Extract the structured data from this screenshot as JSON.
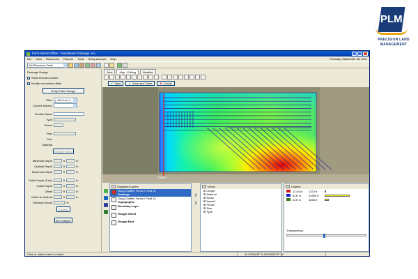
{
  "logo": {
    "mark": "PLM",
    "line1": "PRECISION LAND",
    "line2": "MANAGEMENT"
  },
  "window": {
    "title": "Farm Works Office - Nussbaum Drainage, Inc.",
    "menu": [
      "File",
      "View",
      "Resources",
      "Reports",
      "Tools",
      "Setup Account",
      "Help"
    ],
    "date": "Thursday, September 08, 2011",
    "toolbar_combo": "Job/Resource Tools"
  },
  "left_panel": {
    "title": "Drainage Design",
    "checkboxes": [
      {
        "label": "Show feet and inches",
        "checked": true
      },
      {
        "label": "Modify connection offset",
        "checked": true
      }
    ],
    "verify_button": "Verify Entire Design",
    "filter_label": "Filter",
    "filter_value": "(~All Lines~)",
    "current_section_label": "Current Section",
    "fields": [
      "Section Name",
      "Type",
      "Phase"
    ],
    "pipe_fields": [
      "Pipe",
      "Size",
      "Material"
    ],
    "multiple_sizes_button": "Multiple Sizes",
    "depth_rows": [
      "Minimum Depth",
      "Optimal Depth",
      "Maximum Depth"
    ],
    "outlet_rows": [
      "Outlet Depth (Calc)",
      "Outlet Depth",
      "Offset",
      "Outlet to Optimal",
      "Minimum Slope"
    ],
    "feet_unit": "ft",
    "inch_unit": "in",
    "slope_unit": "%",
    "update_button": "Update",
    "set_defaults_button": "Set Defaults"
  },
  "tabs": [
    "Jobs",
    "Map - Editing",
    "Weather"
  ],
  "edit_toolbar": {
    "save": "Save",
    "save_close": "Save and Close",
    "cancel": "Cancel"
  },
  "map": {
    "outlet_label": "Outlet"
  },
  "displayed_layers": {
    "title": "Displayed Layers",
    "items": [
      {
        "name": "Doug Chaffee Farms / Field 13",
        "type": "Drainage",
        "selected": true
      },
      {
        "name": "Doug Chaffee Farms / Field 13",
        "type": "Topographic",
        "selected": false
      },
      {
        "name": "Boundary Layer",
        "type": "",
        "selected": false
      },
      {
        "name": "Google Street",
        "type": "",
        "selected": false
      },
      {
        "name": "Google East",
        "type": "",
        "selected": false
      }
    ]
  },
  "views": {
    "title": "Views",
    "items": [
      "Length",
      "Material",
      "Name",
      "Name2",
      "Phase",
      "Size",
      "Type"
    ]
  },
  "legend": {
    "title": "Legend",
    "rows": [
      {
        "color": "#d11d1d",
        "value": "12.00 in",
        "length": "1373 ft",
        "fraction": 0.05
      },
      {
        "color": "#1d1dd1",
        "value": "8.00 in",
        "length": "22890 ft",
        "fraction": 0.9
      },
      {
        "color": "#3a7a1e",
        "value": "6.00 in",
        "length": "3836 ft",
        "fraction": 0.15
      }
    ],
    "transparency_label": "Transparency"
  },
  "status": {
    "hint": "Click or rubber-band to select",
    "coords": "41.0750643° N   90.8000070° W"
  },
  "colors": {
    "title_bar": "#0a5fd8",
    "selection": "#316ac5",
    "window_bg": "#ece9d8"
  }
}
